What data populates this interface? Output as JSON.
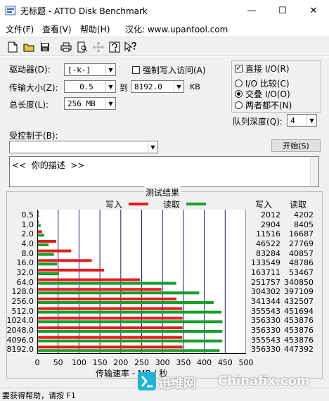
{
  "window": {
    "title": "无标题 - ATTO Disk Benchmark",
    "icon": "disk-benchmark-icon",
    "controls": {
      "minimize": "—",
      "maximize": "☐",
      "close": "✕"
    }
  },
  "menu": {
    "file": "文件(F)",
    "view": "查看(V)",
    "help": "帮助(H)",
    "localized": "汉化: www.upantool.com"
  },
  "toolbar": {
    "icons": [
      "new-icon",
      "open-icon",
      "save-icon",
      "print-icon",
      "print-preview-icon",
      "move-icon",
      "help-icon",
      "context-help-icon"
    ]
  },
  "settings": {
    "drive_label": "驱动器(D):",
    "drive_value": "[-k-]",
    "force_write_label": "强制写入访问(A)",
    "force_write_checked": false,
    "transfer_label": "传输大小(Z):",
    "transfer_from": "0.5",
    "to_label": "到",
    "transfer_to": "8192.0",
    "unit": "KB",
    "length_label": "总长度(L):",
    "length_value": "256 MB",
    "direct_io_label": "直接 I/O(R)",
    "direct_io_checked": true,
    "io_compare_label": "I/O 比较(C)",
    "overlap_io_label": "交叠 I/O(O)",
    "neither_label": "两者都不(N)",
    "selected_io_mode": "overlap",
    "queue_depth_label": "队列深度(Q):",
    "queue_depth_value": "4",
    "controlled_by_label": "受控制于(B):",
    "controlled_by_value": "",
    "start_button": "开始(S)",
    "description": "<<  你的描述  >>"
  },
  "results": {
    "group_title": "测试结果",
    "legend_write": "写入",
    "legend_read": "读取",
    "col_write": "写入",
    "col_read": "读取",
    "xlabel": "传输速率 - MB / 秒",
    "colors": {
      "write": "#e31c1c",
      "read": "#16a02c",
      "grid": "#1a1a8a"
    }
  },
  "chart_data": {
    "type": "bar",
    "orientation": "horizontal",
    "categories": [
      "0.5",
      "1.0",
      "2.0",
      "4.0",
      "8.0",
      "16.0",
      "32.0",
      "64.0",
      "128.0",
      "256.0",
      "512.0",
      "1024.0",
      "2048.0",
      "4096.0",
      "8192.0"
    ],
    "series": [
      {
        "name": "写入",
        "values_kb": [
          2012,
          2904,
          11516,
          46522,
          83284,
          133549,
          163711,
          251757,
          304302,
          341344,
          355543,
          356330,
          356330,
          355543,
          356330
        ],
        "color": "#e31c1c"
      },
      {
        "name": "读取",
        "values_kb": [
          4202,
          8405,
          16687,
          27769,
          40857,
          48786,
          53467,
          340850,
          397109,
          432507,
          451694,
          453876,
          453876,
          453876,
          447392
        ],
        "color": "#16a02c"
      }
    ],
    "x_ticks": [
      "0",
      "50",
      "100",
      "150",
      "200",
      "250",
      "300",
      "350",
      "400",
      "450",
      "500"
    ],
    "xlabel": "传输速率 - MB / 秒",
    "xlim": [
      0,
      500
    ],
    "grid": true,
    "legend": "top"
  },
  "status": {
    "text": "要获得帮助，请按 F1"
  },
  "watermark": {
    "brand_cn": "迅维网",
    "brand_en": "Chinafix.com"
  }
}
